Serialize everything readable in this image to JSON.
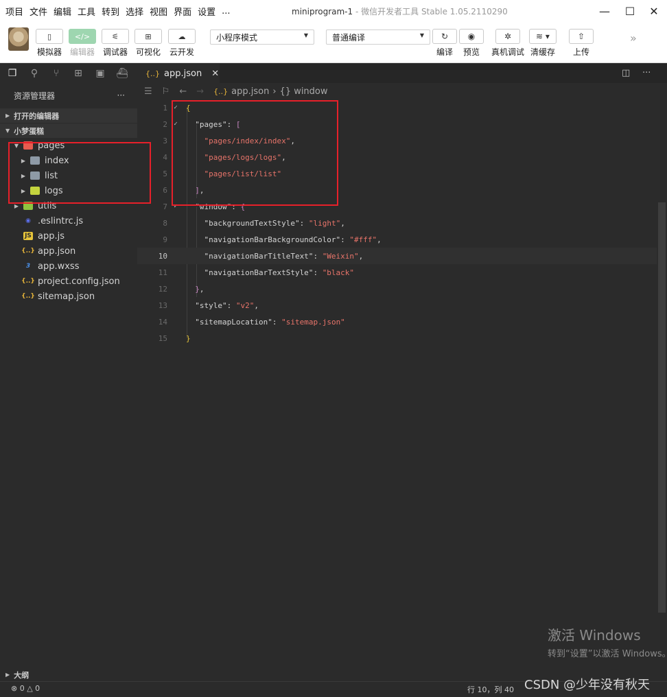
{
  "menubar": {
    "items": [
      "项目",
      "文件",
      "编辑",
      "工具",
      "转到",
      "选择",
      "视图",
      "界面",
      "设置",
      "..."
    ],
    "title": "miniprogram-1",
    "subtitle": "- 微信开发者工具 Stable 1.05.2110290"
  },
  "window_controls": {
    "minimize": "—",
    "maximize": "☐",
    "close": "✕"
  },
  "toolbar": {
    "simulator_label": "模拟器",
    "editor_label": "编辑器",
    "debugger_label": "调试器",
    "visual_label": "可视化",
    "cloud_label": "云开发",
    "mode_dropdown": "小程序模式",
    "compile_dropdown": "普通编译",
    "compile_label": "编译",
    "preview_label": "预览",
    "remote_debug_label": "真机调试",
    "clear_cache_label": "清缓存",
    "upload_label": "上传",
    "more_icon": "»"
  },
  "sidebar": {
    "title": "资源管理器",
    "more": "···",
    "open_editors": "打开的编辑器",
    "project": "小梦蛋糕",
    "outline": "大纲",
    "tree": [
      {
        "name": "pages",
        "depth": 0,
        "expanded": true,
        "type": "pages"
      },
      {
        "name": "index",
        "depth": 1,
        "type": "folder"
      },
      {
        "name": "list",
        "depth": 1,
        "type": "folder"
      },
      {
        "name": "logs",
        "depth": 1,
        "type": "logs"
      },
      {
        "name": "utils",
        "depth": 0,
        "type": "utils"
      },
      {
        "name": ".eslintrc.js",
        "depth": 0,
        "type": "eslint"
      },
      {
        "name": "app.js",
        "depth": 0,
        "type": "js"
      },
      {
        "name": "app.json",
        "depth": 0,
        "type": "json"
      },
      {
        "name": "app.wxss",
        "depth": 0,
        "type": "css"
      },
      {
        "name": "project.config.json",
        "depth": 0,
        "type": "json"
      },
      {
        "name": "sitemap.json",
        "depth": 0,
        "type": "json"
      }
    ]
  },
  "editor": {
    "tab": "app.json",
    "breadcrumb_file": "app.json",
    "breadcrumb_symbol": "{} window",
    "current_line": 10,
    "lines": [
      {
        "n": "1",
        "tokens": [
          [
            "b1",
            "{"
          ]
        ]
      },
      {
        "n": "2",
        "tokens": [
          [
            "k",
            "  \"pages\""
          ],
          [
            "p",
            ": "
          ],
          [
            "b2",
            "["
          ]
        ]
      },
      {
        "n": "3",
        "tokens": [
          [
            "s",
            "    \"pages/index/index\""
          ],
          [
            "p",
            ","
          ]
        ]
      },
      {
        "n": "4",
        "tokens": [
          [
            "s",
            "    \"pages/logs/logs\""
          ],
          [
            "p",
            ","
          ]
        ]
      },
      {
        "n": "5",
        "tokens": [
          [
            "s",
            "    \"pages/list/list\""
          ]
        ]
      },
      {
        "n": "6",
        "tokens": [
          [
            "b2",
            "  ]"
          ],
          [
            "p",
            ","
          ]
        ]
      },
      {
        "n": "7",
        "tokens": [
          [
            "k",
            "  \"window\""
          ],
          [
            "p",
            ": "
          ],
          [
            "b2",
            "{"
          ]
        ]
      },
      {
        "n": "8",
        "tokens": [
          [
            "k",
            "    \"backgroundTextStyle\""
          ],
          [
            "p",
            ": "
          ],
          [
            "s",
            "\"light\""
          ],
          [
            "p",
            ","
          ]
        ]
      },
      {
        "n": "9",
        "tokens": [
          [
            "k",
            "    \"navigationBarBackgroundColor\""
          ],
          [
            "p",
            ": "
          ],
          [
            "s",
            "\"#fff\""
          ],
          [
            "p",
            ","
          ]
        ]
      },
      {
        "n": "10",
        "tokens": [
          [
            "k",
            "    \"navigationBarTitleText\""
          ],
          [
            "p",
            ": "
          ],
          [
            "s",
            "\"Weixin\""
          ],
          [
            "p",
            ","
          ]
        ]
      },
      {
        "n": "11",
        "tokens": [
          [
            "k",
            "    \"navigationBarTextStyle\""
          ],
          [
            "p",
            ": "
          ],
          [
            "s",
            "\"black\""
          ]
        ]
      },
      {
        "n": "12",
        "tokens": [
          [
            "b2",
            "  }"
          ],
          [
            "p",
            ","
          ]
        ]
      },
      {
        "n": "13",
        "tokens": [
          [
            "k",
            "  \"style\""
          ],
          [
            "p",
            ": "
          ],
          [
            "s",
            "\"v2\""
          ],
          [
            "p",
            ","
          ]
        ]
      },
      {
        "n": "14",
        "tokens": [
          [
            "k",
            "  \"sitemapLocation\""
          ],
          [
            "p",
            ": "
          ],
          [
            "s",
            "\"sitemap.json\""
          ]
        ]
      },
      {
        "n": "15",
        "tokens": [
          [
            "b1",
            "}"
          ]
        ]
      }
    ]
  },
  "statusbar": {
    "problems": "⊗ 0 △ 0",
    "position": "行 10，列 40"
  },
  "watermark": {
    "line1": "激活 Windows",
    "line2": "转到“设置”以激活 Windows。",
    "csdn": "CSDN @少年没有秋天"
  },
  "colors": {
    "accent_green": "#9ed6b0",
    "highlight_box": "#e8202a",
    "string": "#e8746a",
    "key": "#d4d4d4"
  }
}
